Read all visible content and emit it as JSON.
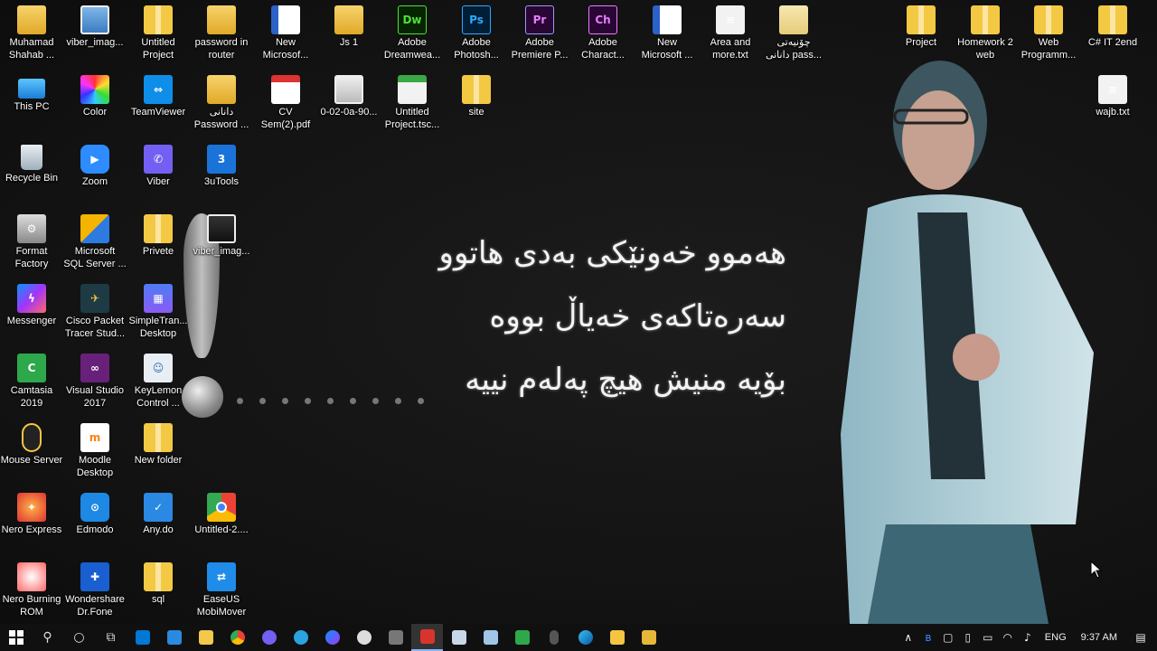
{
  "desktop_icons": {
    "muhamad": "Muhamad\nShahab ...",
    "viber_image_1": "viber_imag...",
    "untitled_project": "Untitled\nProject",
    "password_router": "password in\nrouter",
    "new_microsoft_1": "New\nMicrosof...",
    "js1": "Js 1",
    "dreamweaver": "Adobe\nDreamwea...",
    "photoshop": "Adobe\nPhotosh...",
    "premiere": "Adobe\nPremiere P...",
    "character": "Adobe\nCharact...",
    "new_microsoft_2": "New\nMicrosoft ...",
    "area_more": "Area and\nmore.txt",
    "kurdish_pass": "چۆنیەتی\nدانانی pass...",
    "this_pc": "This PC",
    "color": "Color",
    "teamviewer": "TeamViewer",
    "kurdish_password": "دانانی\nPassword ...",
    "cv": "CV\nSem(2).pdf",
    "file_0202": "0-02-0a-90...",
    "untitled_tsc": "Untitled\nProject.tsc...",
    "site": "site",
    "recycle_bin": "Recycle Bin",
    "zoom": "Zoom",
    "viber": "Viber",
    "threeutools": "3uTools",
    "format_factory": "Format\nFactory",
    "sql_server": "Microsoft\nSQL Server ...",
    "privete": "Privete",
    "viber_image_2": "viber_imag...",
    "messenger": "Messenger",
    "cisco": "Cisco Packet\nTracer Stud...",
    "simpletran": "SimpleTran...\nDesktop",
    "camtasia": "Camtasia\n2019",
    "visual_studio": "Visual Studio\n2017",
    "keylemon": "KeyLemon\nControl ...",
    "mouse_server": "Mouse Server",
    "moodle": "Moodle\nDesktop",
    "new_folder": "New folder",
    "nero_express": "Nero Express",
    "edmodo": "Edmodo",
    "anydo": "Any.do",
    "untitled2": "Untitled-2....",
    "nero_burning": "Nero Burning\nROM",
    "drfone": "Wondershare\nDr.Fone",
    "sql": "sql",
    "easeus": "EaseUS\nMobiMover",
    "project": "Project",
    "homework2": "Homework 2\nweb",
    "web_programming": "Web\nProgramm...",
    "csharp": "C# IT 2end",
    "wajb": "wajb.txt"
  },
  "glyphs": {
    "word": "W",
    "dreamweaver": "Dw",
    "photoshop": "Ps",
    "premiere": "Pr",
    "character": "Ch",
    "pdf": "PDF",
    "txt": "≡",
    "edmodo": "⊙"
  },
  "wallpaper_text": {
    "line1": "هەموو خەونێکی بەدی هاتوو",
    "line2": "سەرەتاکەی خەیاڵ بووە",
    "line3": "بۆیە منیش هیچ پەلەم نییە"
  },
  "taskbar": {
    "start_icon": "windows-logo",
    "tray": {
      "language": "ENG",
      "time": "9:37 AM"
    }
  },
  "colors": {
    "taskbar_bg": "#101010",
    "accent": "#8ab4f8",
    "desktop_bg": "#141414"
  }
}
